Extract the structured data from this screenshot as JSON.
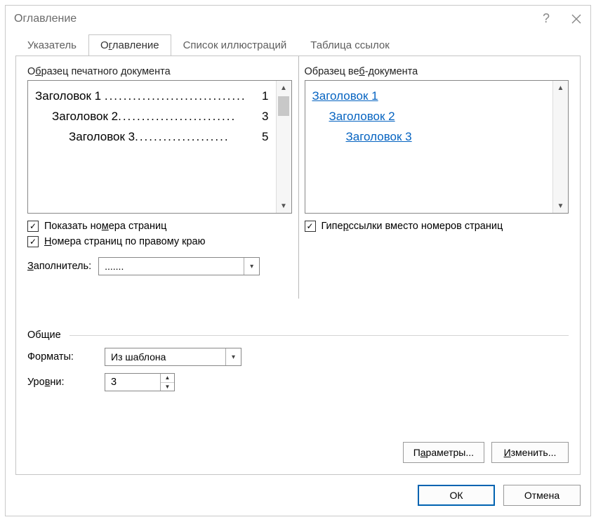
{
  "title": "Оглавление",
  "tabs": {
    "index": "Указатель",
    "toc": "Оглавление",
    "illustrations": "Список иллюстраций",
    "citations": "Таблица ссылок"
  },
  "print_preview": {
    "label_pre": "О",
    "label_u": "б",
    "label_post": "разец печатного документа",
    "lines": [
      {
        "text": "Заголовок 1",
        "page": "1",
        "indent": 0
      },
      {
        "text": "Заголовок 2",
        "page": "3",
        "indent": 1
      },
      {
        "text": "Заголовок 3",
        "page": "5",
        "indent": 2
      }
    ]
  },
  "web_preview": {
    "label_pre": "Образец ве",
    "label_u": "б",
    "label_post": "-документа",
    "lines": [
      {
        "text": "Заголовок 1",
        "indent": 0
      },
      {
        "text": "Заголовок 2",
        "indent": 1
      },
      {
        "text": "Заголовок 3",
        "indent": 2
      }
    ]
  },
  "checks": {
    "show_pages_pre": "Показать но",
    "show_pages_u": "м",
    "show_pages_post": "ера страниц",
    "right_align_pre": "",
    "right_align_u": "Н",
    "right_align_post": "омера страниц по правому краю",
    "hyperlinks_pre": "Гипе",
    "hyperlinks_u": "р",
    "hyperlinks_post": "ссылки вместо номеров страниц"
  },
  "leader": {
    "label_pre": "",
    "label_u": "З",
    "label_post": "аполнитель:",
    "value": "......."
  },
  "general": {
    "title": "Общие",
    "formats_label": "Форматы:",
    "formats_value": "Из шаблона",
    "levels_label_pre": "Уро",
    "levels_label_u": "в",
    "levels_label_post": "ни:",
    "levels_value": "3"
  },
  "buttons": {
    "options_pre": "П",
    "options_u": "а",
    "options_post": "раметры...",
    "modify_pre": "",
    "modify_u": "И",
    "modify_post": "зменить...",
    "ok": "ОК",
    "cancel": "Отмена"
  }
}
